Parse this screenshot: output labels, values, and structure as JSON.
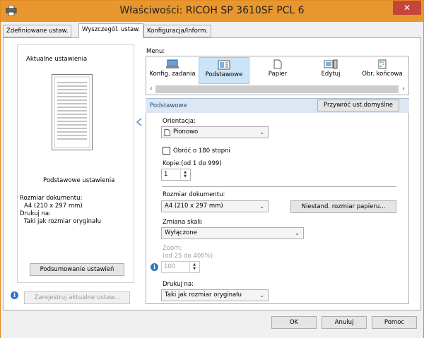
{
  "window": {
    "title": "Właściwości: RICOH SP 3610SF PCL 6",
    "close_glyph": "✕"
  },
  "tabs": [
    {
      "label": "Zdefiniowane ustaw."
    },
    {
      "label": "Wyszczegól. ustaw."
    },
    {
      "label": "Konfiguracja/Inform."
    }
  ],
  "left": {
    "group_label": "Aktualne ustawienia",
    "summary_title": "Podstawowe ustawienia",
    "lines": [
      "Rozmiar dokumentu:",
      "A4 (210 x 297 mm)",
      "Drukuj na:",
      "Taki jak rozmiar oryginału"
    ],
    "summary_button": "Podsumowanie ustawień",
    "register_button": "Zarejestruj aktualne ustaw..."
  },
  "menu": {
    "label": "Menu:",
    "items": [
      {
        "label": "Konfig. zadania",
        "icon": "job-setup-icon"
      },
      {
        "label": "Podstawowe",
        "icon": "basic-icon"
      },
      {
        "label": "Papier",
        "icon": "paper-icon"
      },
      {
        "label": "Edytuj",
        "icon": "edit-icon"
      },
      {
        "label": "Obr. końcowa",
        "icon": "finishing-icon"
      }
    ],
    "selected_index": 1
  },
  "section": {
    "title": "Podstawowe",
    "reset_button": "Przywróć ust.domyślne"
  },
  "settings": {
    "orientation_label": "Orientacja:",
    "orientation_value": "Pionowo",
    "rotate_label": "Obróć o 180 stopni",
    "rotate_checked": false,
    "copies_label": "Kopie:(od 1 do 999)",
    "copies_value": "1",
    "doc_size_label": "Rozmiar dokumentu:",
    "doc_size_value": "A4 (210 x 297 mm)",
    "custom_size_button": "Niestand. rozmiar papieru...",
    "scale_label": "Zmiana skali:",
    "scale_value": "Wyłączone",
    "zoom_label": "Zoom:",
    "zoom_range": "(od 25 do 400%)",
    "zoom_value": "100",
    "print_on_label": "Drukuj na:",
    "print_on_value": "Taki jak rozmiar oryginału"
  },
  "footer": {
    "ok": "OK",
    "cancel": "Anuluj",
    "help": "Pomoc"
  },
  "colors": {
    "titlebar": "#e8972f",
    "close": "#c7443a",
    "selection": "#cce4f7",
    "section": "#dde7f2",
    "info": "#2c76c4"
  }
}
